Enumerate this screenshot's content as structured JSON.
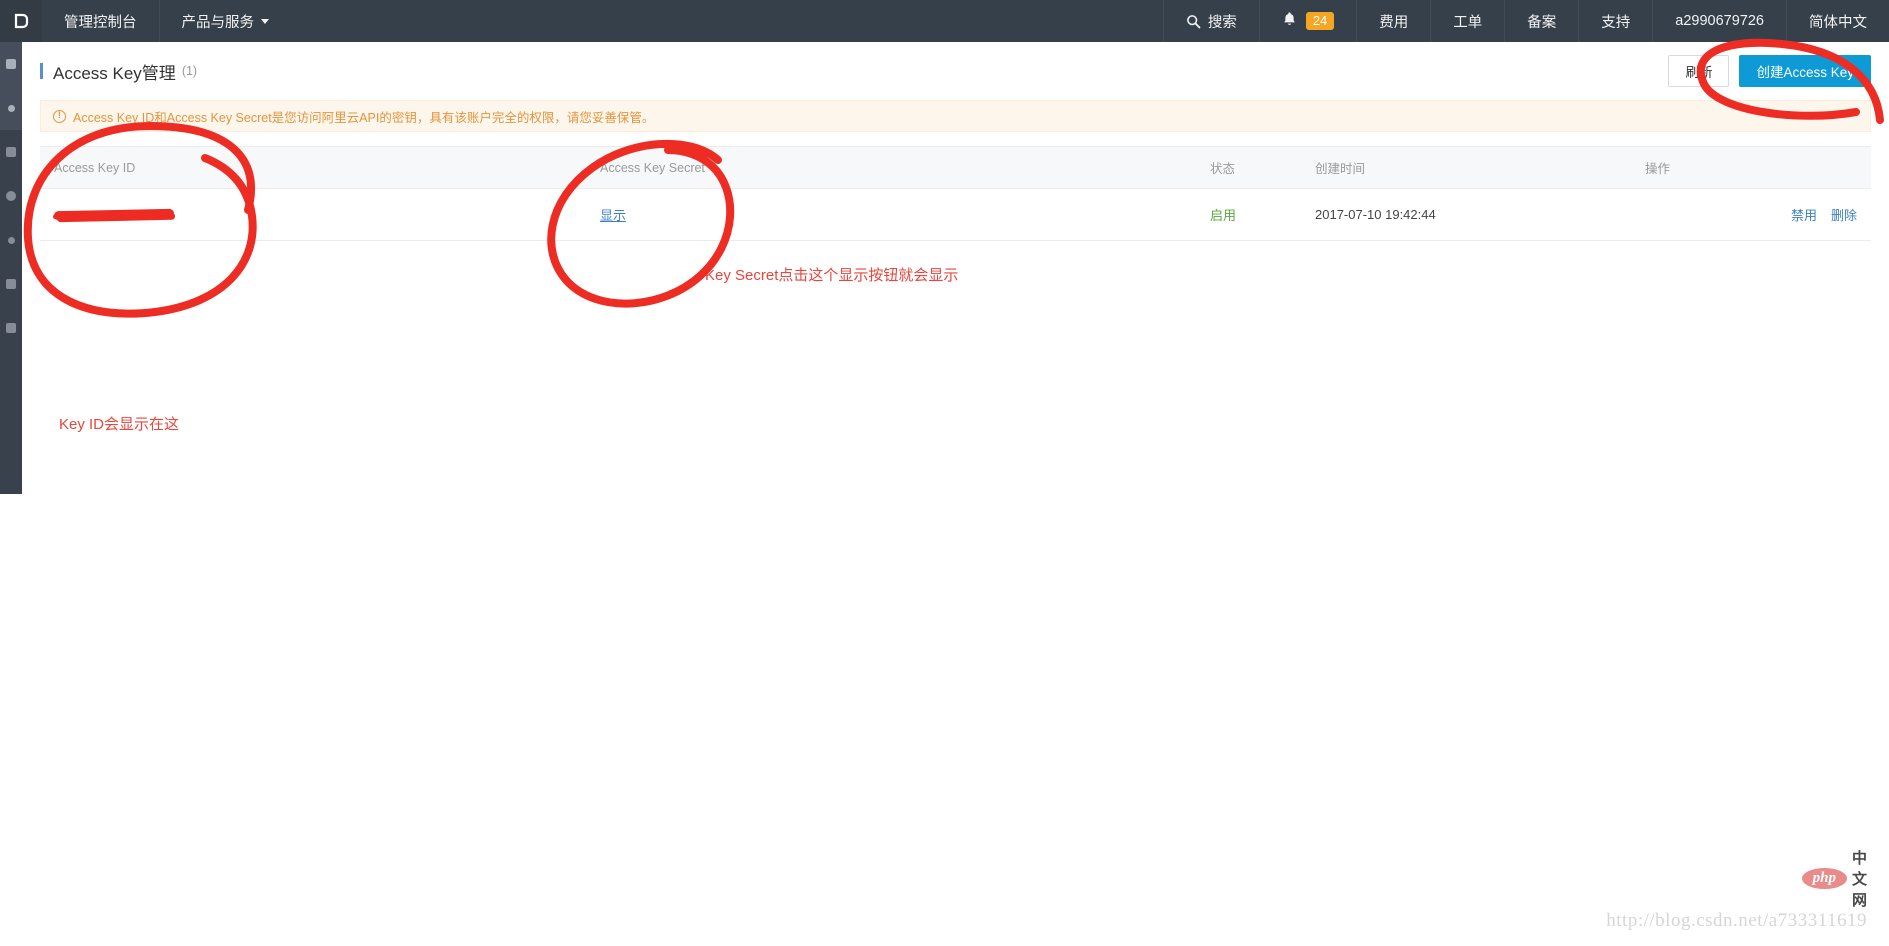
{
  "topnav": {
    "logo_icon": "cloud-logo-icon",
    "left_items": [
      {
        "label": "管理控制台",
        "name": "nav-console",
        "caret": false
      },
      {
        "label": "产品与服务",
        "name": "nav-products-services",
        "caret": true
      }
    ],
    "search": {
      "label": "搜索",
      "icon": "search-icon"
    },
    "notifications": {
      "icon": "bell-icon",
      "count": "24",
      "badge_color": "#f5a623"
    },
    "right_items": [
      {
        "label": "费用",
        "name": "nav-billing"
      },
      {
        "label": "工单",
        "name": "nav-tickets"
      },
      {
        "label": "备案",
        "name": "nav-icp"
      },
      {
        "label": "支持",
        "name": "nav-support"
      },
      {
        "label": "a2990679726",
        "name": "nav-account"
      },
      {
        "label": "简体中文",
        "name": "nav-language"
      }
    ],
    "background": "#36404a"
  },
  "leftrail": {
    "icons": [
      "menu-icon",
      "pin-icon",
      "grid-icon",
      "cloud-icon",
      "dot-icon",
      "layers-icon",
      "server-icon"
    ]
  },
  "page": {
    "title": "Access Key管理",
    "count": "(1)",
    "accent": "#5b8fc9",
    "buttons": {
      "refresh": "刷新",
      "create": "创建Access Key",
      "create_color": "#0e9ad4"
    }
  },
  "alert": {
    "icon": "warning-circle-icon",
    "text": "Access Key ID和Access Key Secret是您访问阿里云API的密钥，具有该账户完全的权限，请您妥善保管。",
    "text_color": "#e6943c",
    "bg_color": "#fdf6ec"
  },
  "table": {
    "headers": {
      "id": "Access Key ID",
      "secret": "Access Key Secret",
      "status": "状态",
      "created": "创建时间",
      "actions": "操作"
    },
    "rows": [
      {
        "id_value": "",
        "id_redacted": true,
        "secret_action": "显示",
        "status": "启用",
        "status_color": "#5aa83c",
        "created": "2017-07-10 19:42:44",
        "actions": [
          "禁用",
          "删除"
        ]
      }
    ]
  },
  "annotations": {
    "color": "#e8453c",
    "secret_note": "Key Secret点击这个显示按钮就会显示",
    "keyid_note": "Key ID会显示在这",
    "circles": [
      "circle-around-access-key-id",
      "circle-around-show-button",
      "circle-around-create-button"
    ]
  },
  "watermark": {
    "url": "http://blog.csdn.net/a733311619",
    "logo_php": "php",
    "logo_cn": "中文网"
  }
}
